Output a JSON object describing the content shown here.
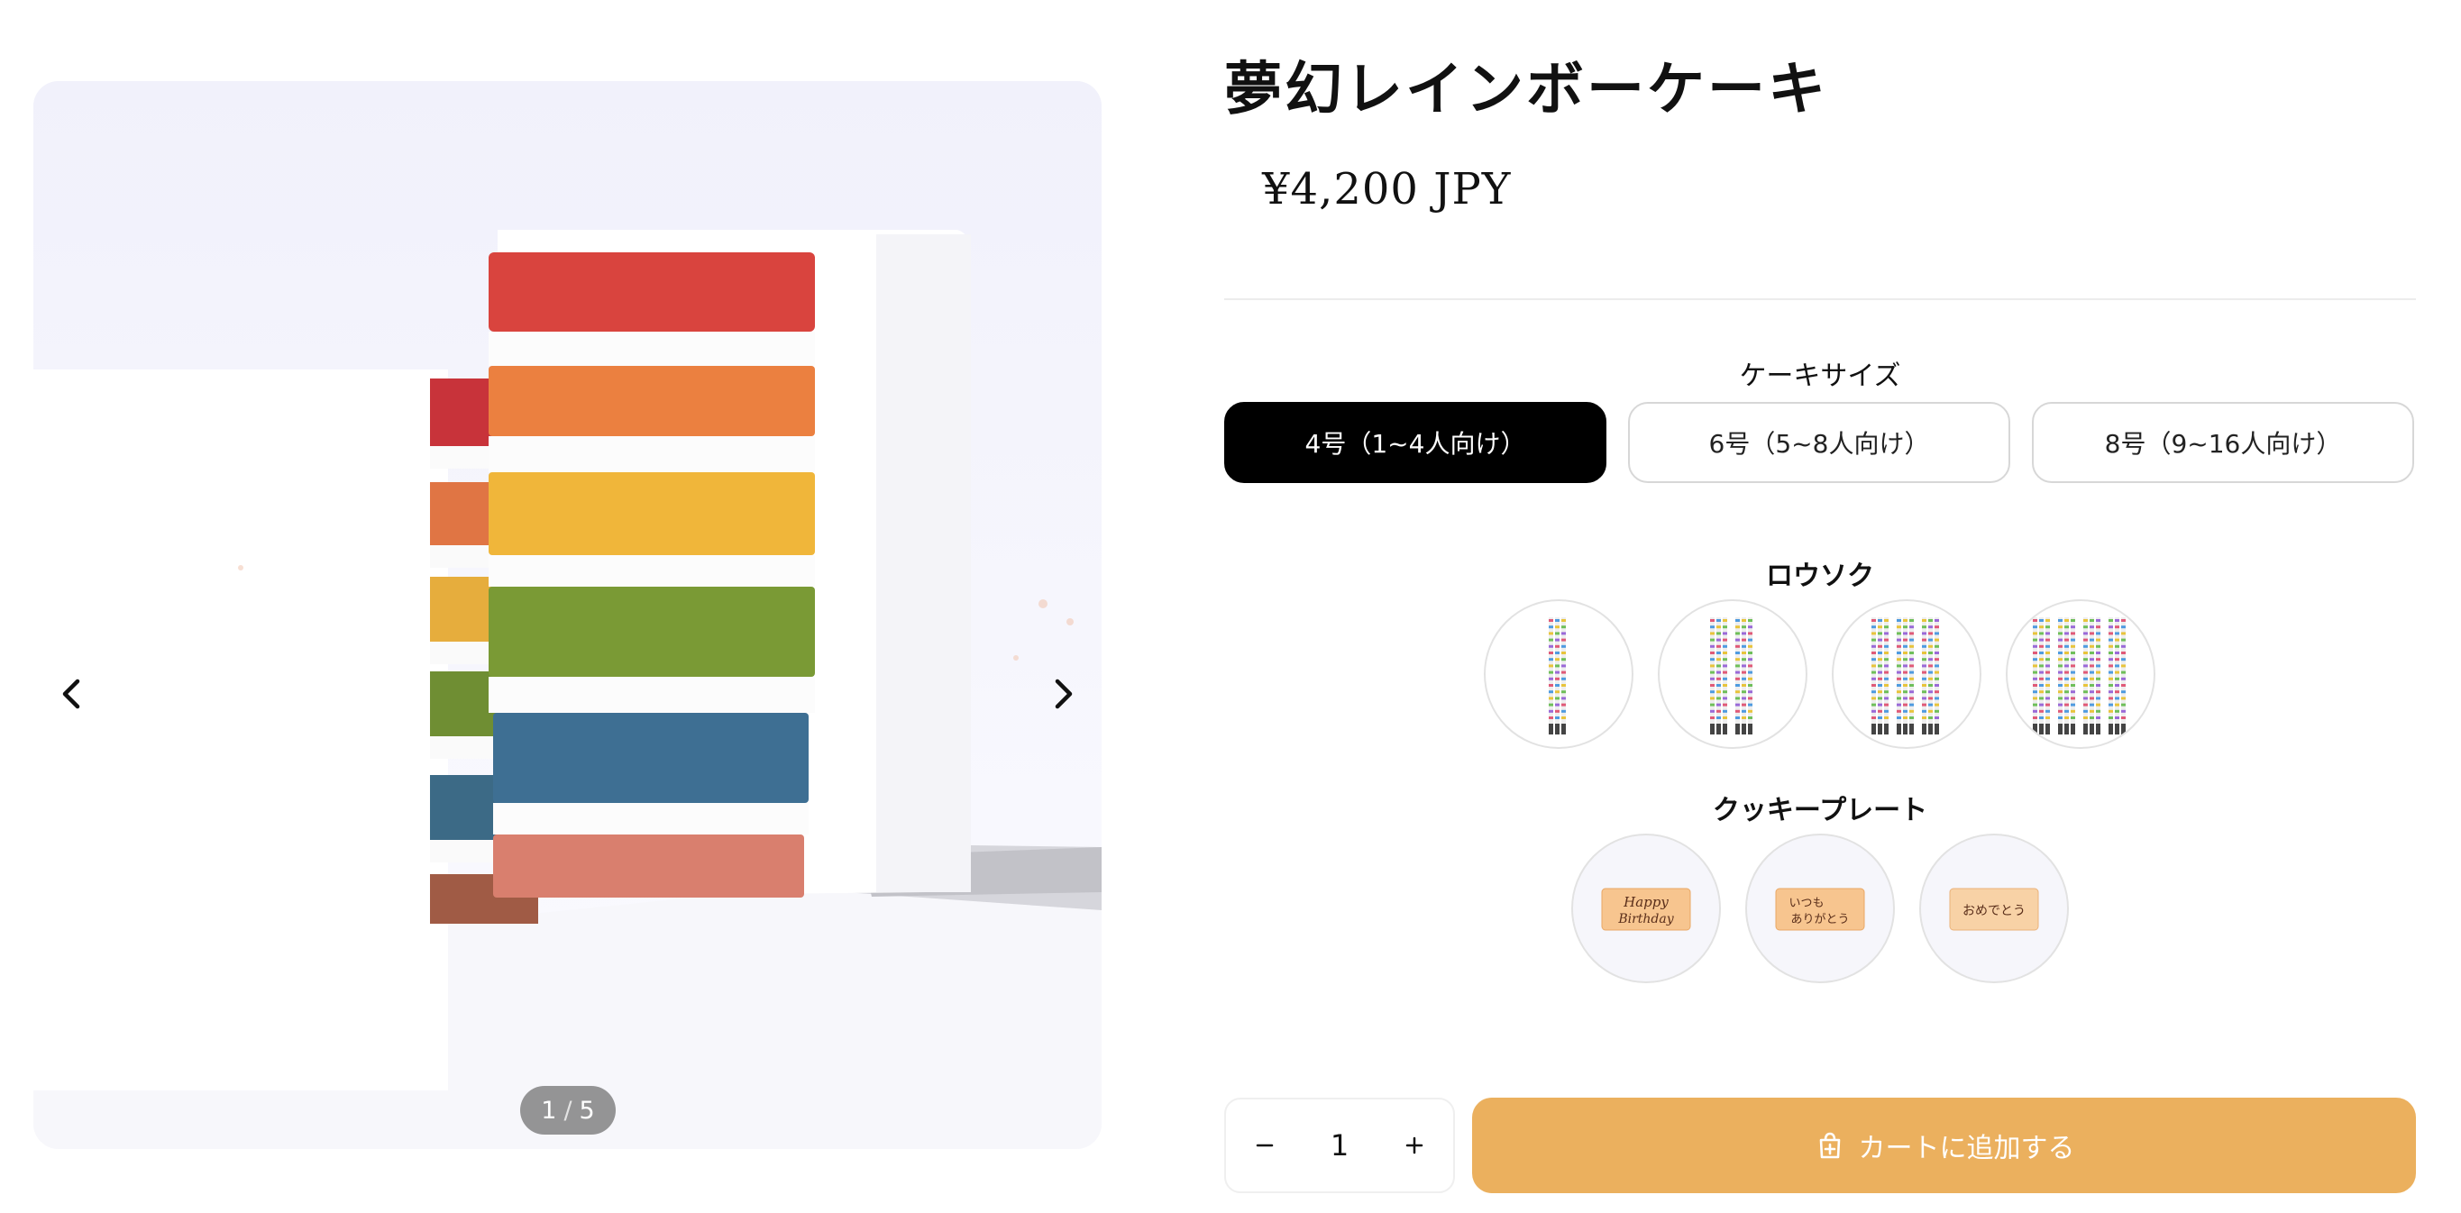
{
  "product": {
    "title": "夢幻レインボーケーキ",
    "price": "¥4,200 JPY"
  },
  "gallery": {
    "current": "1",
    "separator": "/",
    "total": "5",
    "prev_icon": "chevron-left-icon",
    "next_icon": "chevron-right-icon"
  },
  "options": {
    "size_label": "ケーキサイズ",
    "sizes": [
      {
        "label": "4号（1~4人向け）",
        "selected": true
      },
      {
        "label": "6号（5~8人向け）",
        "selected": false
      },
      {
        "label": "8号（9~16人向け）",
        "selected": false
      }
    ],
    "candle_label": "ロウソク",
    "candles": [
      {
        "bundles": 1
      },
      {
        "bundles": 2
      },
      {
        "bundles": 3
      },
      {
        "bundles": 4
      }
    ],
    "cookie_label": "クッキープレート",
    "cookies": [
      {
        "line1": "Happy",
        "line2": "Birthday"
      },
      {
        "line1": "いつも",
        "line2": "ありがとう"
      },
      {
        "line1": "おめでとう",
        "line2": ""
      }
    ]
  },
  "purchase": {
    "quantity": "1",
    "minus_icon": "minus-icon",
    "plus_icon": "plus-icon",
    "cart_icon": "cart-add-icon",
    "add_to_cart": "カートに追加する"
  },
  "colors": {
    "accent": "#ebb05e",
    "selected": "#000000",
    "layers": [
      "#d9443e",
      "#eb8040",
      "#f0b63a",
      "#7a9a35",
      "#3e6f93",
      "#d97f6e"
    ]
  }
}
